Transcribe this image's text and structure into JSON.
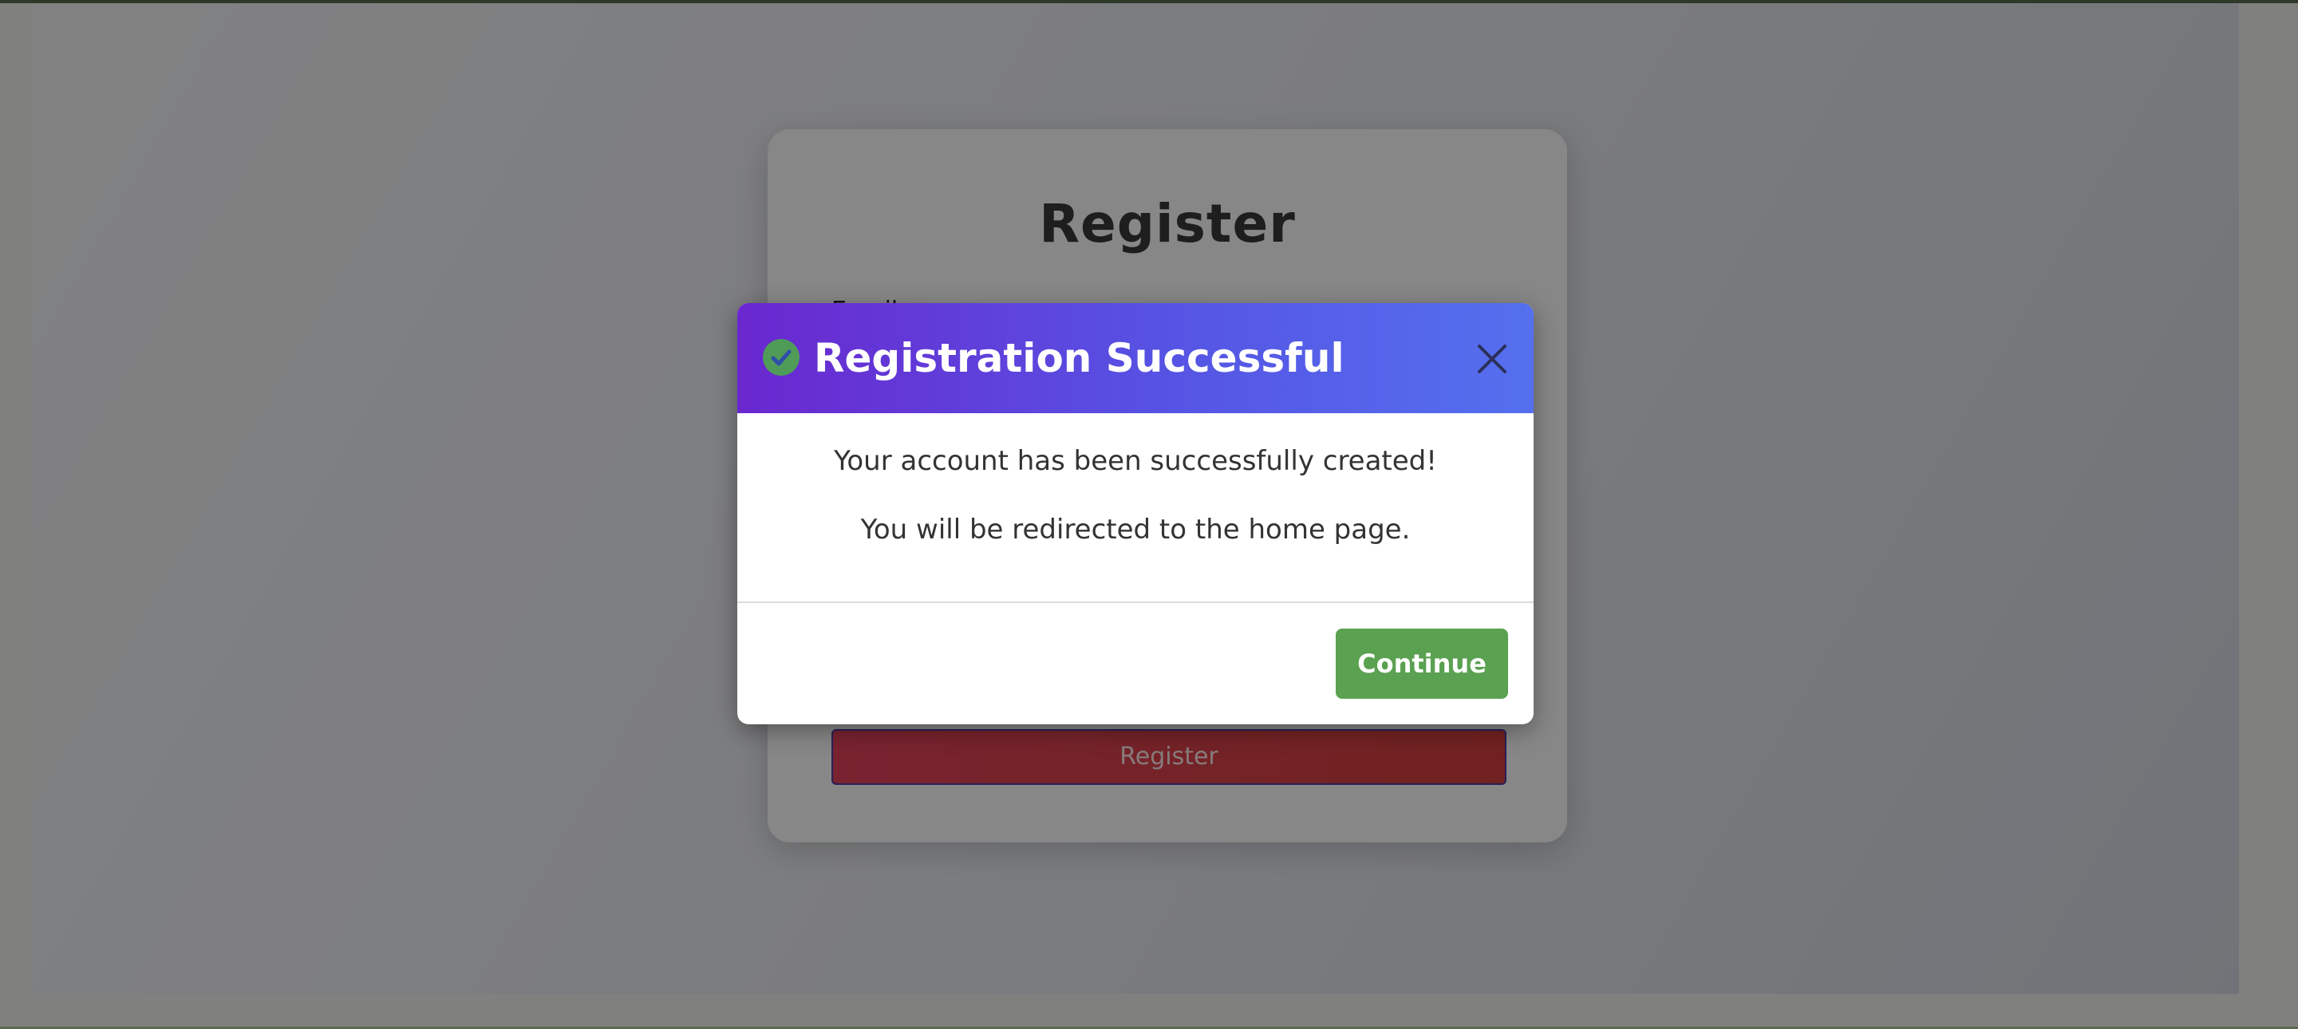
{
  "register_form": {
    "title": "Register",
    "email_label": "Email",
    "submit_label": "Register"
  },
  "modal": {
    "title": "Registration Successful",
    "message_line1": "Your account has been successfully created!",
    "message_line2": "You will be redirected to the home page.",
    "continue_label": "Continue",
    "icons": {
      "status": "check-circle-icon",
      "close": "close-icon"
    }
  },
  "colors": {
    "header_gradient_start": "#6a27cf",
    "header_gradient_end": "#5470ee",
    "success_green": "#5aa151",
    "register_button": "#e4435b"
  }
}
